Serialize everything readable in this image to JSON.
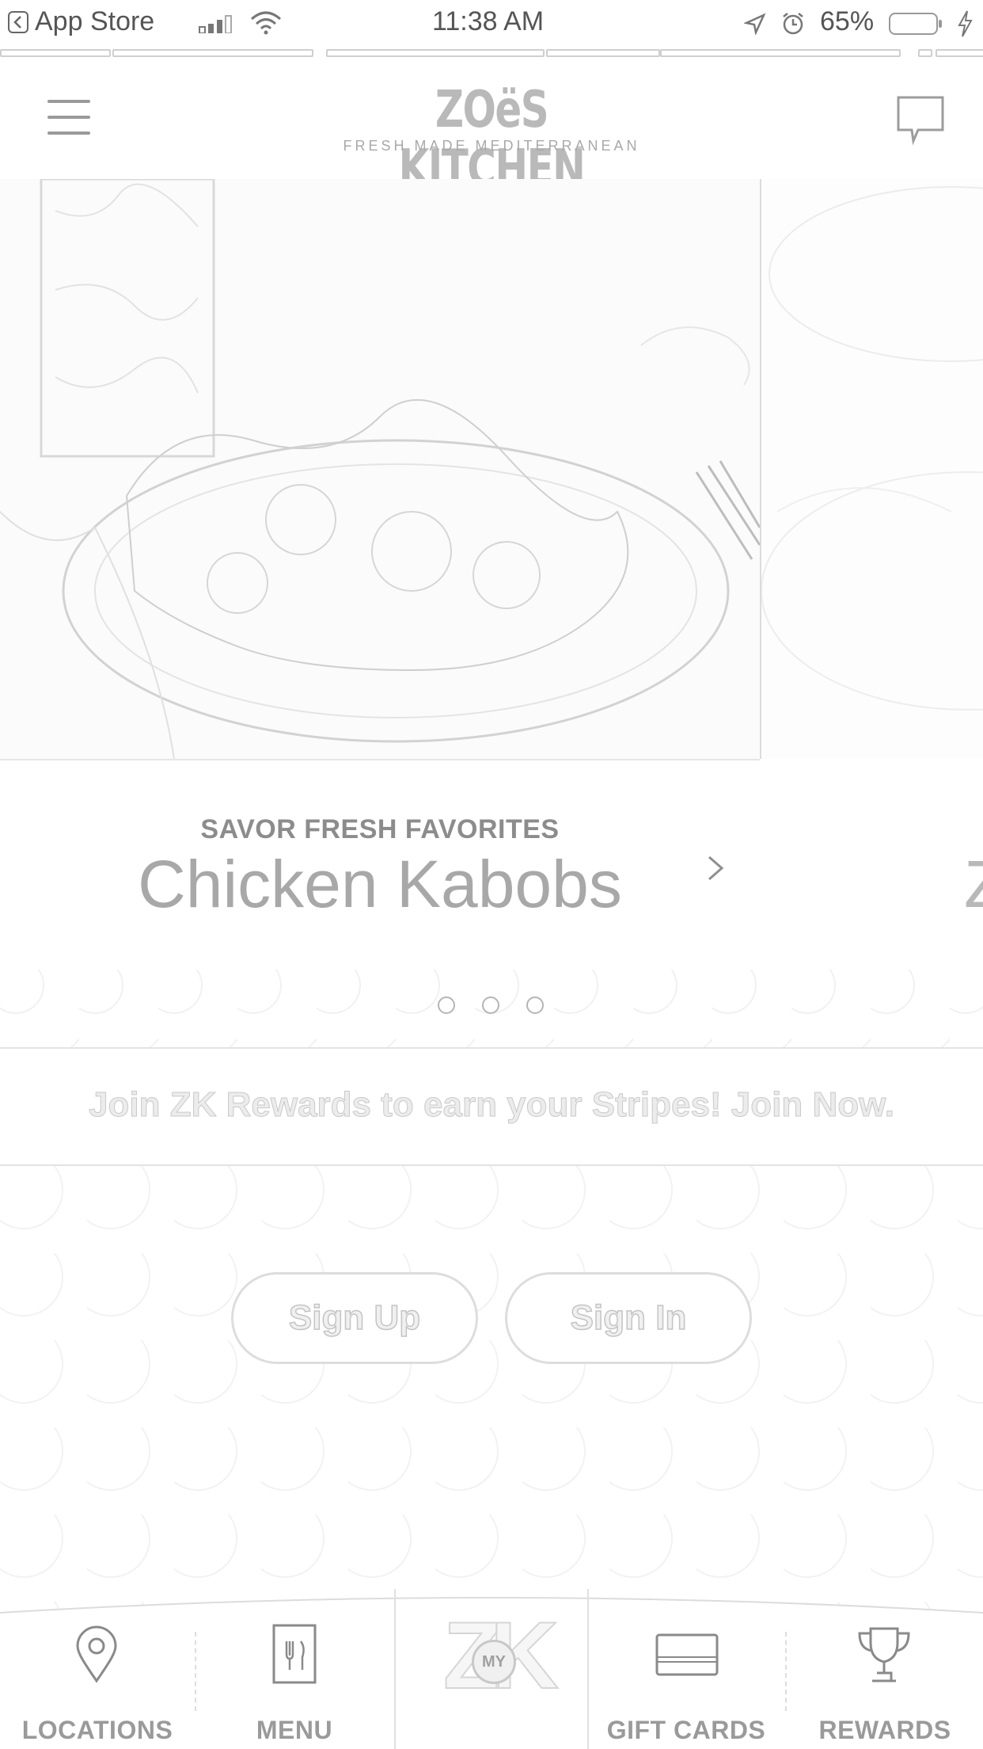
{
  "status_bar": {
    "back_app": "App Store",
    "time": "11:38 AM",
    "battery": "65%"
  },
  "header": {
    "logo_title": "ZOëS KITCHEN",
    "logo_subtitle": "FRESH MADE MEDITERRANEAN"
  },
  "hero": {
    "kicker": "SAVOR FRESH FAVORITES",
    "title": "Chicken Kabobs",
    "next_peek": "Z",
    "slide_count": 3,
    "active_slide": 1
  },
  "rewards_banner": {
    "text": "Join ZK Rewards to earn your Stripes! Join Now."
  },
  "auth": {
    "signup_label": "Sign Up",
    "signin_label": "Sign In"
  },
  "tabbar": {
    "locations": "LOCATIONS",
    "menu": "MENU",
    "center_badge": "MY",
    "center_letters": "ZK",
    "gift_cards": "GIFT CARDS",
    "rewards": "REWARDS"
  },
  "colors": {
    "text_gray": "#8a8a8a",
    "line_gray": "#e0e0e0",
    "background": "#ffffff"
  }
}
